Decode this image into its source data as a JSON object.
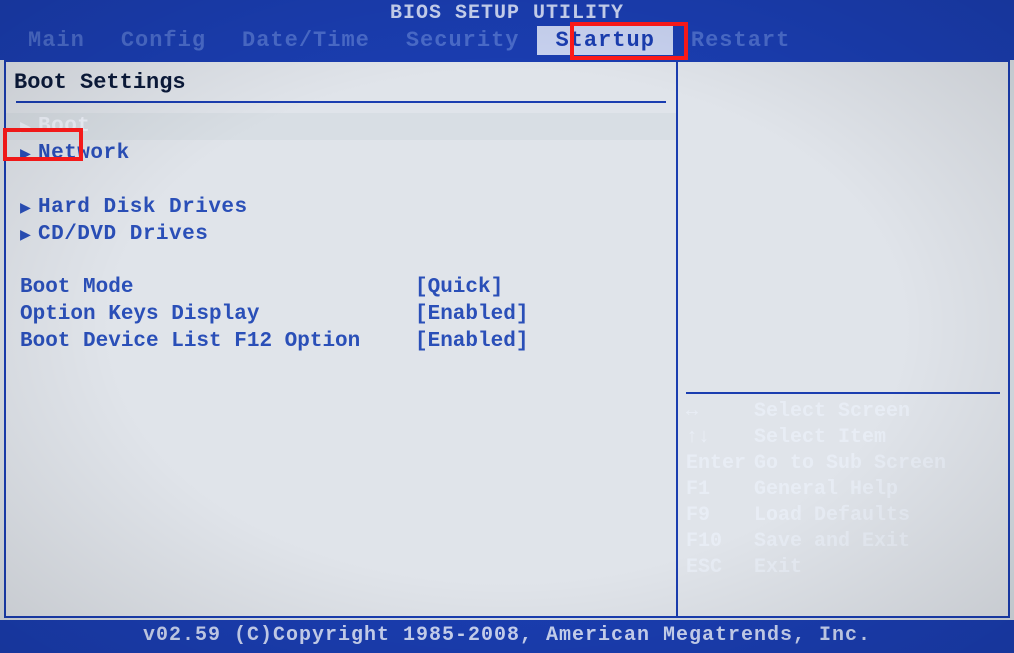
{
  "title": "BIOS SETUP UTILITY",
  "tabs": [
    {
      "label": "Main"
    },
    {
      "label": "Config"
    },
    {
      "label": "Date/Time"
    },
    {
      "label": "Security"
    },
    {
      "label": "Startup"
    },
    {
      "label": "Restart"
    }
  ],
  "active_tab": "Startup",
  "section_heading": "Boot Settings",
  "submenus": [
    {
      "label": "Boot",
      "selected": true
    },
    {
      "label": "Network",
      "selected": false
    },
    {
      "label": "Hard Disk Drives",
      "selected": false
    },
    {
      "label": "CD/DVD Drives",
      "selected": false
    }
  ],
  "settings": [
    {
      "key": "Boot Mode",
      "value": "[Quick]"
    },
    {
      "key": "Option Keys Display",
      "value": "[Enabled]"
    },
    {
      "key": "Boot Device List F12 Option",
      "value": "[Enabled]"
    }
  ],
  "help": [
    {
      "key": "↔",
      "desc": "Select Screen"
    },
    {
      "key": "↑↓",
      "desc": "Select Item"
    },
    {
      "key": "Enter",
      "desc": "Go to Sub Screen"
    },
    {
      "key": "F1",
      "desc": "General Help"
    },
    {
      "key": "F9",
      "desc": "Load Defaults"
    },
    {
      "key": "F10",
      "desc": "Save and Exit"
    },
    {
      "key": "ESC",
      "desc": "Exit"
    }
  ],
  "footer": "v02.59 (C)Copyright 1985-2008, American Megatrends, Inc."
}
